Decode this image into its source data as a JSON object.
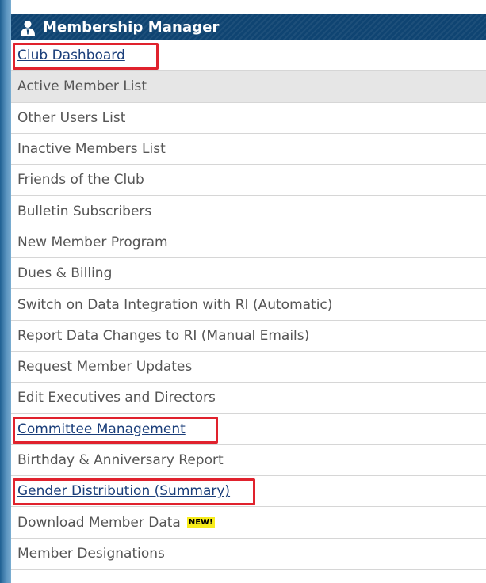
{
  "header": {
    "title": "Membership Manager",
    "icon": "user-icon"
  },
  "menu": {
    "items": [
      {
        "label": "Club Dashboard",
        "link": true,
        "highlighted": true
      },
      {
        "label": "Active Member List",
        "selected": true
      },
      {
        "label": "Other Users List"
      },
      {
        "label": "Inactive Members List"
      },
      {
        "label": "Friends of the Club"
      },
      {
        "label": "Bulletin Subscribers"
      },
      {
        "label": "New Member Program"
      },
      {
        "label": "Dues & Billing"
      },
      {
        "label": "Switch on Data Integration with RI (Automatic)"
      },
      {
        "label": "Report Data Changes to RI (Manual Emails)"
      },
      {
        "label": "Request Member Updates"
      },
      {
        "label": "Edit Executives and Directors"
      },
      {
        "label": "Committee Management",
        "link": true,
        "highlighted": true
      },
      {
        "label": "Birthday & Anniversary Report"
      },
      {
        "label": "Gender Distribution (Summary)",
        "link": true,
        "highlighted": true
      },
      {
        "label": "Download Member Data",
        "badge": "NEW!"
      },
      {
        "label": "Member Designations"
      }
    ]
  },
  "colors": {
    "header_bg": "#0f4472",
    "link": "#1a3e7a",
    "highlight_box": "#e0222d",
    "new_badge": "#f7ec1b"
  }
}
